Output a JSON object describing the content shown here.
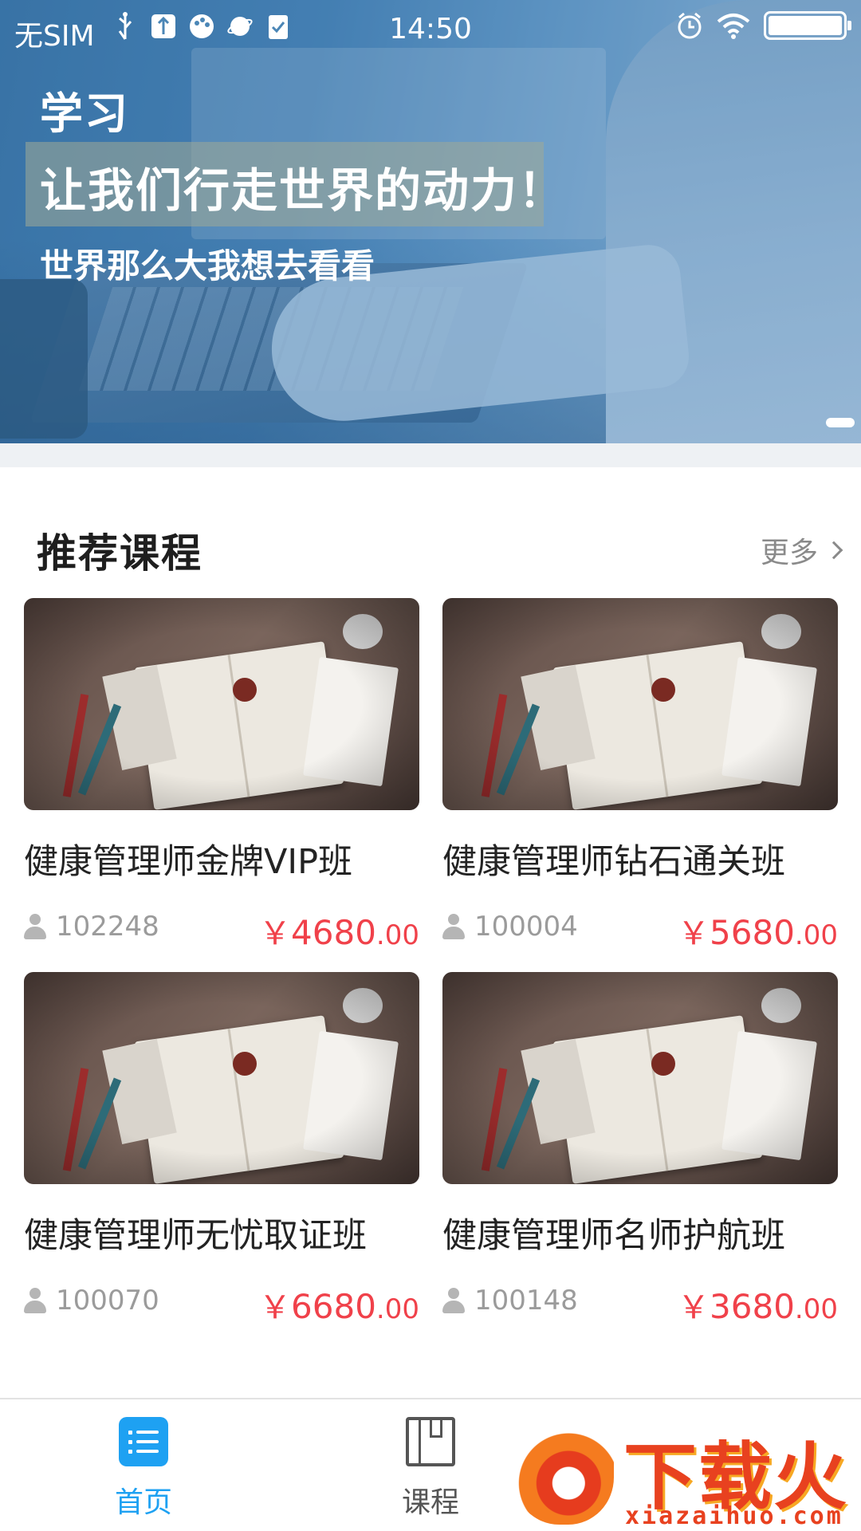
{
  "status_bar": {
    "carrier": "无SIM",
    "time": "14:50",
    "left_icons": [
      "usb-icon",
      "debug-icon",
      "palette-icon",
      "planet-icon",
      "clipboard-check-icon"
    ],
    "right_icons": [
      "alarm-icon",
      "wifi-icon",
      "battery-icon"
    ]
  },
  "banner": {
    "subject": "学习",
    "title": "让我们行走世界的动力！",
    "subtitle": "世界那么大我想去看看",
    "page_indicator": {
      "current": 1,
      "total": 1
    }
  },
  "section": {
    "title": "推荐课程",
    "more_label": "更多"
  },
  "courses": [
    {
      "title": "健康管理师金牌VIP班",
      "students": "102248",
      "currency": "￥",
      "price_int": "4680",
      "price_dec": ".00"
    },
    {
      "title": "健康管理师钻石通关班",
      "students": "100004",
      "currency": "￥",
      "price_int": "5680",
      "price_dec": ".00"
    },
    {
      "title": "健康管理师无忧取证班",
      "students": "100070",
      "currency": "￥",
      "price_int": "6680",
      "price_dec": ".00"
    },
    {
      "title": "健康管理师名师护航班",
      "students": "100148",
      "currency": "￥",
      "price_int": "3680",
      "price_dec": ".00"
    }
  ],
  "tabbar": {
    "items": [
      {
        "label": "首页",
        "icon": "list-icon",
        "active": true
      },
      {
        "label": "课程",
        "icon": "book-icon",
        "active": false
      }
    ]
  },
  "watermark": {
    "brand": "下载火",
    "url": "xiazaihuo.com"
  },
  "colors": {
    "accent": "#1ea1f2",
    "price": "#f0414a",
    "muted": "#9b9b9b"
  }
}
